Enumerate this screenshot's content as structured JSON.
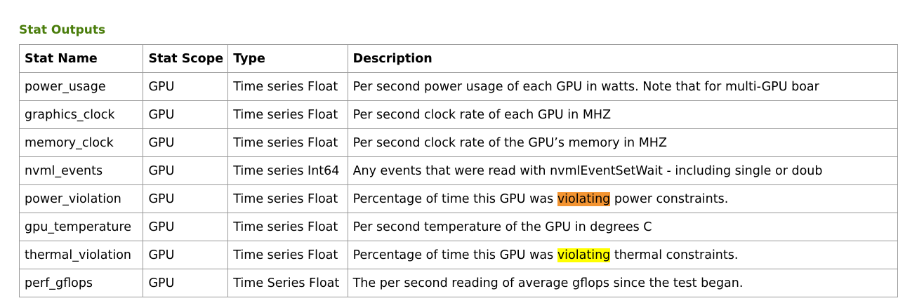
{
  "section_title": "Stat Outputs",
  "table": {
    "headers": [
      "Stat Name",
      "Stat Scope",
      "Type",
      "Description"
    ],
    "rows": [
      {
        "name": "power_usage",
        "scope": "GPU",
        "type": "Time series Float",
        "desc_pre": "Per second power usage of each GPU in watts. Note that for multi-GPU boar",
        "desc_hl": "",
        "desc_post": ""
      },
      {
        "name": "graphics_clock",
        "scope": "GPU",
        "type": "Time series Float",
        "desc_pre": "Per second clock rate of each GPU in MHZ",
        "desc_hl": "",
        "desc_post": ""
      },
      {
        "name": "memory_clock",
        "scope": "GPU",
        "type": "Time series Float",
        "desc_pre": "Per second clock rate of the GPU’s memory in MHZ",
        "desc_hl": "",
        "desc_post": ""
      },
      {
        "name": "nvml_events",
        "scope": "GPU",
        "type": "Time series Int64",
        "desc_pre": "Any events that were read with nvmlEventSetWait - including single or doub",
        "desc_hl": "",
        "desc_post": ""
      },
      {
        "name": "power_violation",
        "scope": "GPU",
        "type": "Time series Float",
        "desc_pre": "Percentage of time this GPU was ",
        "desc_hl": "violating",
        "desc_post": " power constraints."
      },
      {
        "name": "gpu_temperature",
        "scope": "GPU",
        "type": "Time series Float",
        "desc_pre": "Per second temperature of the GPU in degrees C",
        "desc_hl": "",
        "desc_post": ""
      },
      {
        "name": "thermal_violation",
        "scope": "GPU",
        "type": "Time series Float",
        "desc_pre": "Percentage of time this GPU was ",
        "desc_hl": "violating",
        "desc_post": " thermal constraints."
      },
      {
        "name": "perf_gflops",
        "scope": "GPU",
        "type": "Time Series Float",
        "desc_pre": "The per second reading of average gflops since the test began.",
        "desc_hl": "",
        "desc_post": ""
      }
    ]
  },
  "colors": {
    "title": "#4a7d0b",
    "highlight_orange": "#f39431",
    "highlight_yellow": "#ffff00",
    "border": "#999999"
  }
}
